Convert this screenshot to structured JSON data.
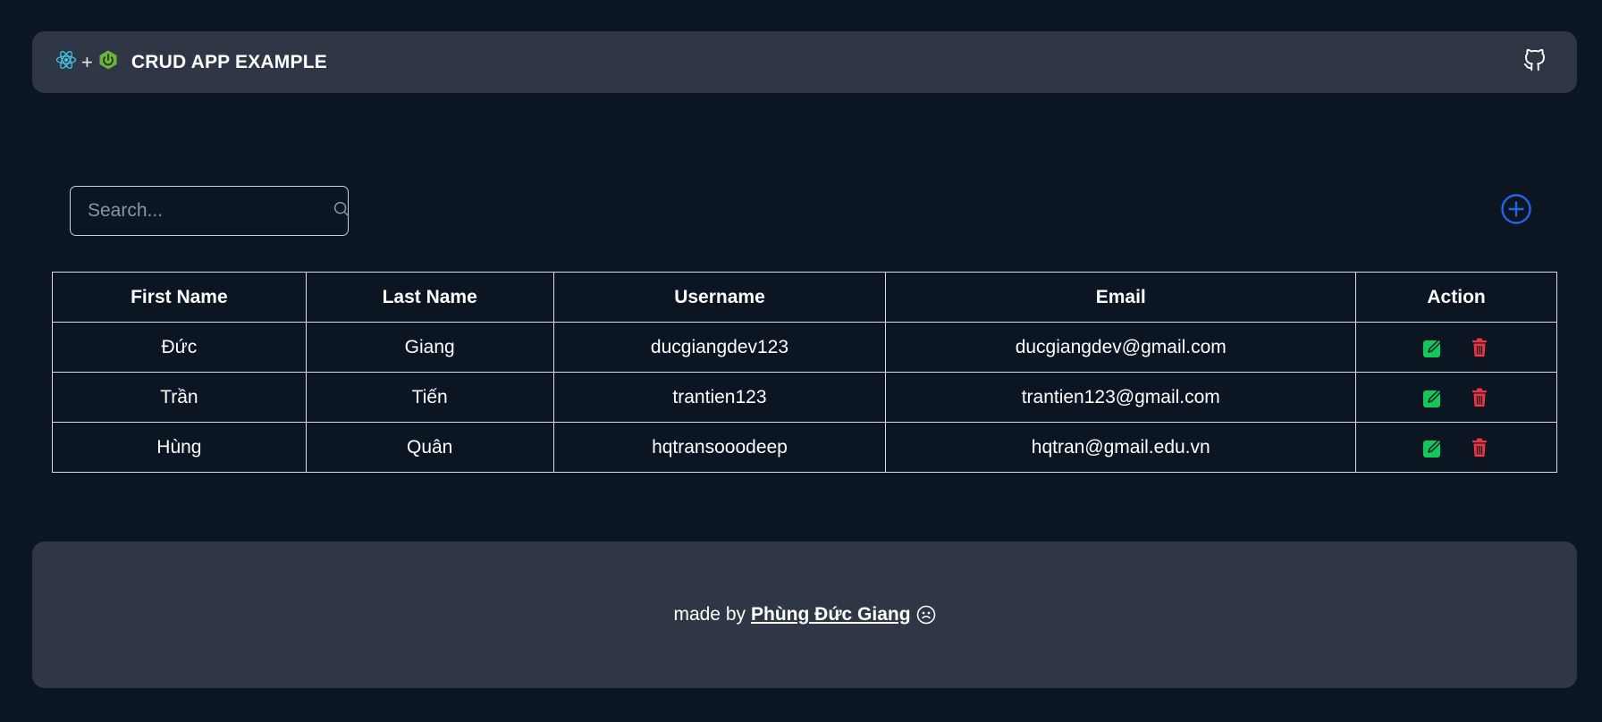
{
  "header": {
    "title": "CRUD APP EXAMPLE",
    "plus_symbol": "+",
    "react_icon": "react-logo-icon",
    "spring_icon": "spring-logo-icon",
    "github_icon": "github-icon"
  },
  "search": {
    "placeholder": "Search...",
    "value": "",
    "icon": "search-icon"
  },
  "add_button": {
    "icon": "plus-circle-icon"
  },
  "table": {
    "columns": [
      "First Name",
      "Last Name",
      "Username",
      "Email",
      "Action"
    ],
    "rows": [
      {
        "first_name": "Đức",
        "last_name": "Giang",
        "username": "ducgiangdev123",
        "email": "ducgiangdev@gmail.com"
      },
      {
        "first_name": "Trần",
        "last_name": "Tiến",
        "username": "trantien123",
        "email": "trantien123@gmail.com"
      },
      {
        "first_name": "Hùng",
        "last_name": "Quân",
        "username": "hqtransooodeep",
        "email": "hqtran@gmail.edu.vn"
      }
    ],
    "edit_icon": "edit-icon",
    "delete_icon": "trash-icon"
  },
  "footer": {
    "prefix": "made by",
    "author": "Phùng Đức Giang",
    "icon": "smile-icon"
  },
  "colors": {
    "background": "#0b1622",
    "panel": "#2f3747",
    "accent_blue": "#2563eb",
    "edit_green": "#16c65a",
    "delete_red": "#ef3340"
  }
}
